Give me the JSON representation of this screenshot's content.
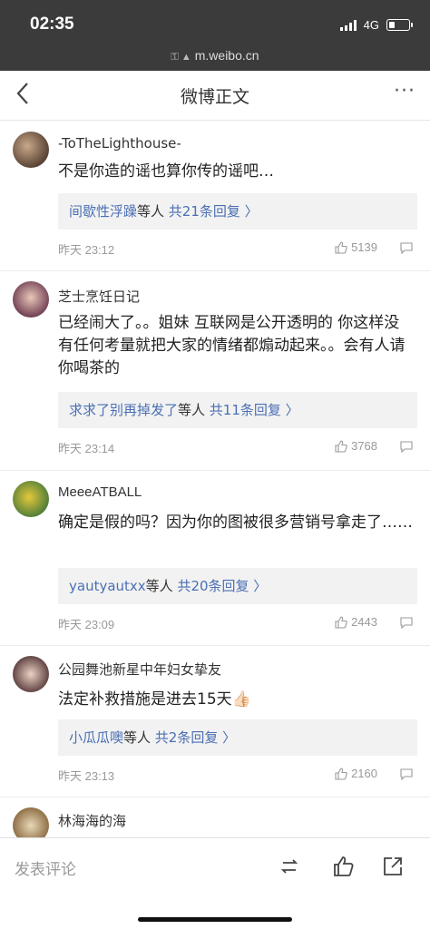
{
  "status": {
    "time": "02:35",
    "network": "4G"
  },
  "browser": {
    "url": "m.weibo.cn"
  },
  "nav": {
    "title": "微博正文",
    "more": "···"
  },
  "comments": [
    {
      "name": "-ToTheLighthouse-",
      "text": "不是你造的谣也算你传的谣吧…",
      "reply_who": "间歇性浮躁",
      "reply_mid": "等人 ",
      "reply_count": "共21条回复 〉",
      "time": "昨天 23:12",
      "likes": "5139"
    },
    {
      "name": "芝士烹饪日记",
      "text": "已经闹大了。。姐妹 互联网是公开透明的 你这样没有任何考量就把大家的情绪都煽动起来。。会有人请你喝茶的",
      "reply_who": "求求了别再掉发了",
      "reply_mid": "等人 ",
      "reply_count": "共11条回复 〉",
      "time": "昨天 23:14",
      "likes": "3768"
    },
    {
      "name": "MeeeATBALL",
      "text": "确定是假的吗？因为你的图被很多营销号拿走了……",
      "reply_who": "yautyautxx",
      "reply_mid": "等人 ",
      "reply_count": "共20条回复 〉",
      "time": "昨天 23:09",
      "likes": "2443"
    },
    {
      "name": "公园舞池新星中年妇女挚友",
      "text": "法定补救措施是进去15天👍🏻",
      "reply_who": "小瓜瓜噢",
      "reply_mid": "等人 ",
      "reply_count": "共2条回复 〉",
      "time": "昨天 23:13",
      "likes": "2160"
    },
    {
      "name": "林海海的海"
    }
  ],
  "bottom": {
    "placeholder": "发表评论"
  },
  "colors": {
    "link": "#4a6fb4",
    "statusbar": "#3b3b3b"
  }
}
